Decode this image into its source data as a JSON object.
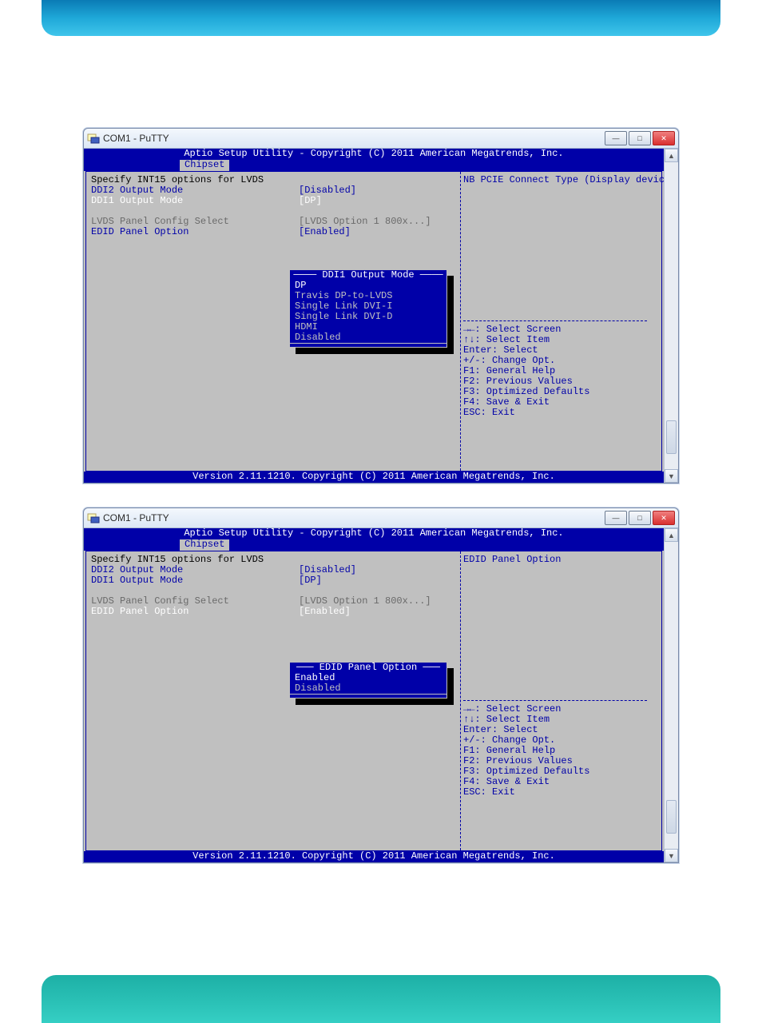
{
  "banner": {
    "top_color": "#1fa8d8",
    "bottom_color": "#2bc2b7"
  },
  "window": {
    "title": "COM1 - PuTTY",
    "buttons": {
      "minimize": "—",
      "maximize": "□",
      "close": "✕"
    }
  },
  "bios": {
    "header": "Aptio Setup Utility - Copyright (C) 2011 American Megatrends, Inc.",
    "tab": "Chipset",
    "footer": "Version 2.11.1210. Copyright (C) 2011 American Megatrends, Inc.",
    "section_title": "Specify INT15 options for LVDS",
    "items": [
      {
        "label": "DDI2 Output Mode",
        "value": "[Disabled]",
        "style": "blue"
      },
      {
        "label": "DDI1 Output Mode",
        "value": "[DP]",
        "style": "white"
      },
      {
        "label": "",
        "value": "",
        "style": "blank"
      },
      {
        "label": "LVDS Panel Config Select",
        "value": "[LVDS Option 1 800x...]",
        "style": "gray"
      },
      {
        "label": "EDID Panel Option",
        "value": "[Enabled]",
        "style": "blue"
      }
    ],
    "help_keys": [
      "→←: Select Screen",
      "↑↓: Select Item",
      "Enter: Select",
      "+/-: Change Opt.",
      "F1: General Help",
      "F2: Previous Values",
      "F3: Optimized Defaults",
      "F4: Save & Exit",
      "ESC: Exit"
    ]
  },
  "screen1": {
    "description": "NB PCIE Connect Type (Display device)",
    "popup": {
      "title": "DDI1 Output Mode",
      "options": [
        "DP",
        "Travis DP-to-LVDS",
        "Single Link DVI-I",
        "Single Link DVI-D",
        "HDMI",
        "Disabled"
      ],
      "selected_index": 0
    },
    "highlight_item_index": 1
  },
  "screen2": {
    "description": "EDID Panel Option",
    "popup": {
      "title": "EDID Panel Option",
      "options": [
        "Enabled",
        "Disabled"
      ],
      "selected_index": 0
    },
    "highlight_item_index": 4
  }
}
